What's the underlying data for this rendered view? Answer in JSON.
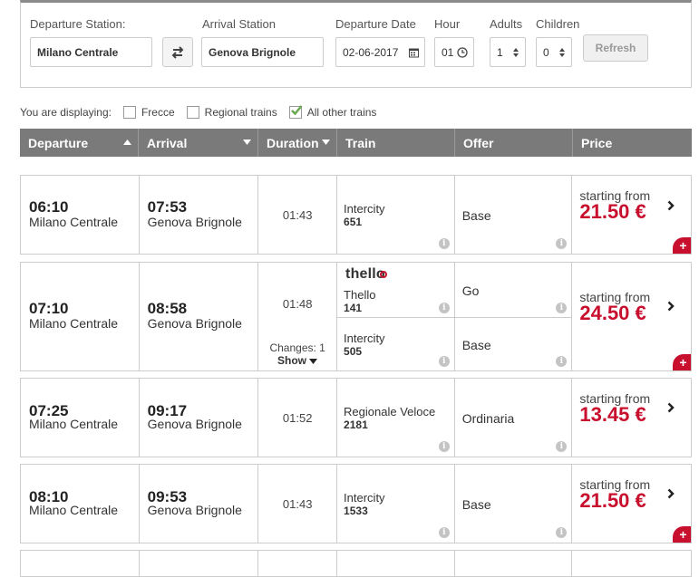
{
  "search": {
    "departure_label": "Departure Station:",
    "departure_value": "Milano Centrale",
    "arrival_label": "Arrival Station",
    "arrival_value": "Genova Brignole",
    "date_label": "Departure Date",
    "date_value": "02-06-2017",
    "hour_label": "Hour",
    "hour_value": "01",
    "adults_label": "Adults",
    "adults_value": "1",
    "children_label": "Children",
    "children_value": "0",
    "refresh_label": "Refresh"
  },
  "filters": {
    "prefix": "You are displaying:",
    "items": [
      {
        "label": "Frecce",
        "checked": false
      },
      {
        "label": "Regional trains",
        "checked": false
      },
      {
        "label": "All other trains",
        "checked": true
      }
    ]
  },
  "table": {
    "headers": [
      "Departure",
      "Arrival",
      "Duration",
      "Train",
      "Offer",
      "Price"
    ]
  },
  "results": [
    {
      "dep_time": "06:10",
      "dep_station": "Milano Centrale",
      "arr_time": "07:53",
      "arr_station": "Genova Brignole",
      "duration": "01:43",
      "segments": [
        {
          "train": "Intercity",
          "number": "651",
          "offer": "Base"
        }
      ],
      "from_label": "starting from",
      "price": "21.50 €"
    },
    {
      "dep_time": "07:10",
      "dep_station": "Milano Centrale",
      "arr_time": "08:58",
      "arr_station": "Genova Brignole",
      "duration": "01:48",
      "changes": "Changes: 1",
      "show_label": "Show",
      "logo_text": "thello",
      "segments": [
        {
          "train": "Thello",
          "number": "141",
          "offer": "Go"
        },
        {
          "train": "Intercity",
          "number": "505",
          "offer": "Base"
        }
      ],
      "from_label": "starting from",
      "price": "24.50 €"
    },
    {
      "dep_time": "07:25",
      "dep_station": "Milano Centrale",
      "arr_time": "09:17",
      "arr_station": "Genova Brignole",
      "duration": "01:52",
      "segments": [
        {
          "train": "Regionale Veloce",
          "number": "2181",
          "offer": "Ordinaria"
        }
      ],
      "from_label": "starting from",
      "price": "13.45 €"
    },
    {
      "dep_time": "08:10",
      "dep_station": "Milano Centrale",
      "arr_time": "09:53",
      "arr_station": "Genova Brignole",
      "duration": "01:43",
      "segments": [
        {
          "train": "Intercity",
          "number": "1533",
          "offer": "Base"
        }
      ],
      "from_label": "starting from",
      "price": "21.50 €"
    }
  ],
  "colors": {
    "accent": "#c8102e",
    "header_bg": "#7a7a7a",
    "checkmark": "#6aa84f"
  },
  "icons": [
    "swap-icon",
    "calendar-icon",
    "clock-icon",
    "updown-icon",
    "sort-up-icon",
    "sort-down-icon",
    "info-icon",
    "chevron-right-icon",
    "plus-icon",
    "checkmark-icon"
  ]
}
